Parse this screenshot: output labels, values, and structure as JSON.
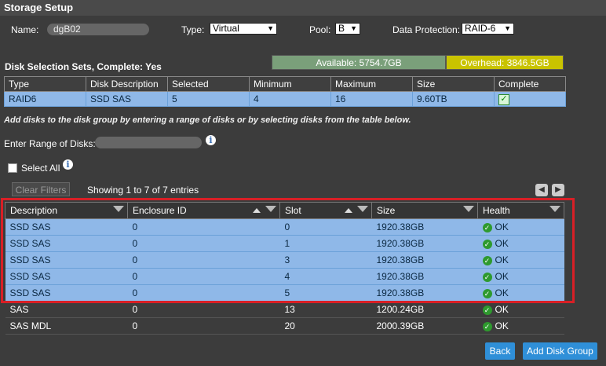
{
  "window": {
    "title": "Storage Setup"
  },
  "form": {
    "name_label": "Name:",
    "name_value": "dgB02",
    "type_label": "Type:",
    "type_value": "Virtual",
    "pool_label": "Pool:",
    "pool_value": "B",
    "protection_label": "Data Protection:",
    "protection_value": "RAID-6"
  },
  "sets": {
    "header": "Disk Selection Sets, Complete: Yes",
    "available": "Available: 5754.7GB",
    "overhead": "Overhead: 3846.5GB",
    "columns": [
      "Type",
      "Disk Description",
      "Selected",
      "Minimum",
      "Maximum",
      "Size",
      "Complete"
    ],
    "row": {
      "type": "RAID6",
      "desc": "SSD SAS",
      "selected": "5",
      "minimum": "4",
      "maximum": "16",
      "size": "9.60TB",
      "complete": "✓"
    }
  },
  "instructions": "Add disks to the disk group by entering a range of disks or by selecting disks from the table below.",
  "range": {
    "label": "Enter Range of Disks:"
  },
  "select_all": {
    "label": "Select All"
  },
  "filters": {
    "clear_label": "Clear Filters",
    "showing": "Showing 1 to 7 of 7 entries"
  },
  "disks": {
    "columns": [
      "Description",
      "Enclosure ID",
      "Slot",
      "Size",
      "Health"
    ],
    "rows": [
      {
        "desc": "SSD SAS",
        "enc": "0",
        "slot": "0",
        "size": "1920.38GB",
        "health": "OK"
      },
      {
        "desc": "SSD SAS",
        "enc": "0",
        "slot": "1",
        "size": "1920.38GB",
        "health": "OK"
      },
      {
        "desc": "SSD SAS",
        "enc": "0",
        "slot": "3",
        "size": "1920.38GB",
        "health": "OK"
      },
      {
        "desc": "SSD SAS",
        "enc": "0",
        "slot": "4",
        "size": "1920.38GB",
        "health": "OK"
      },
      {
        "desc": "SSD SAS",
        "enc": "0",
        "slot": "5",
        "size": "1920.38GB",
        "health": "OK"
      },
      {
        "desc": "SAS",
        "enc": "0",
        "slot": "13",
        "size": "1200.24GB",
        "health": "OK"
      },
      {
        "desc": "SAS MDL",
        "enc": "0",
        "slot": "20",
        "size": "2000.39GB",
        "health": "OK"
      }
    ]
  },
  "buttons": {
    "back": "Back",
    "add": "Add Disk Group"
  },
  "colors": {
    "accent": "#2f8fd8",
    "highlight": "#8fb8e8",
    "available": "#7a9f7a",
    "overhead": "#c9c300",
    "redbox": "#d81f26"
  }
}
